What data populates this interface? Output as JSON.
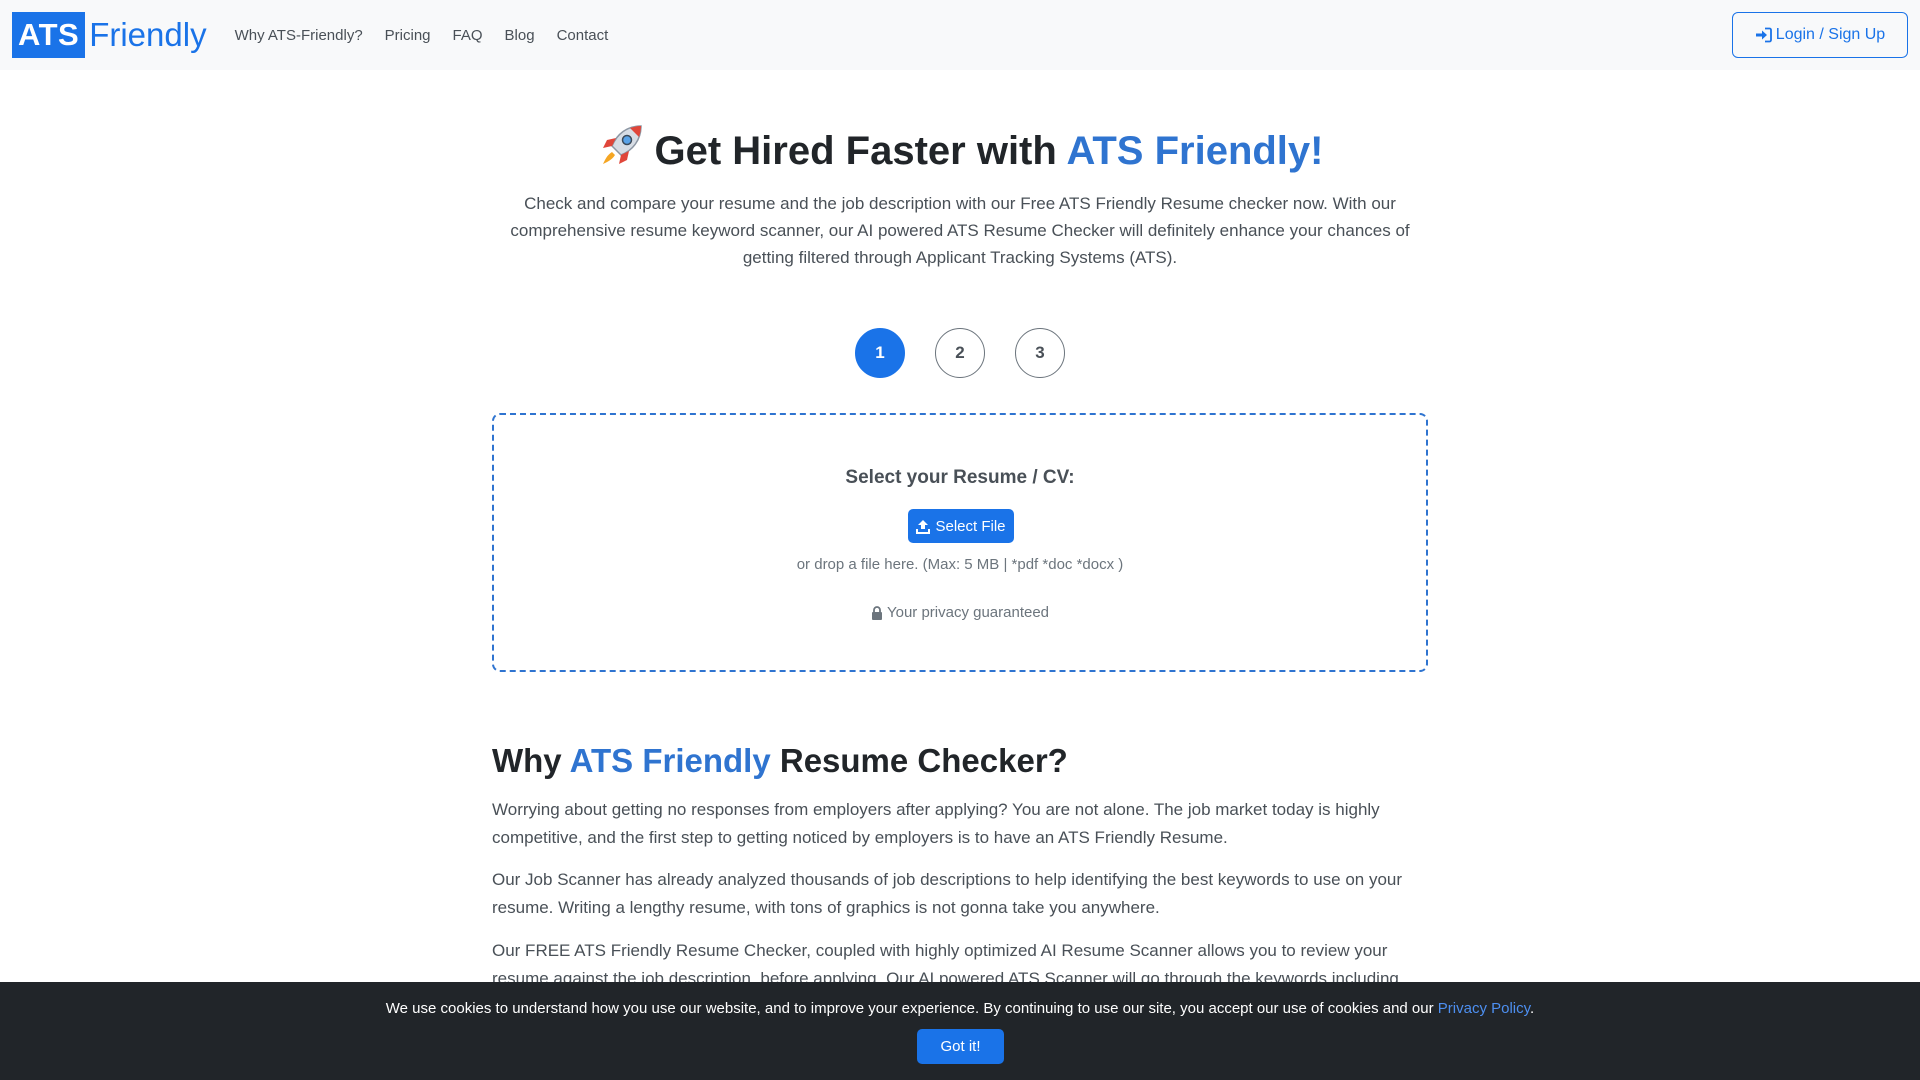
{
  "brand": {
    "logo_box": "ATS",
    "logo_text": "Friendly",
    "accent_color": "#1a73e8"
  },
  "nav": {
    "links": [
      "Why ATS-Friendly?",
      "Pricing",
      "FAQ",
      "Blog",
      "Contact"
    ],
    "login_label": "Login / Sign Up"
  },
  "hero": {
    "title_pre": "Get Hired Faster with ",
    "title_accent": "ATS Friendly!",
    "description": "Check and compare your resume and the job description with our Free ATS Friendly Resume checker now. With our comprehensive resume keyword scanner, our AI powered ATS Resume Checker will definitely enhance your chances of getting filtered through Applicant Tracking Systems (ATS)."
  },
  "steps": {
    "labels": [
      "1",
      "2",
      "3"
    ],
    "active": "1"
  },
  "upload": {
    "title": "Select your Resume / CV:",
    "button_label": "Select File",
    "hint": "or drop a file here. (Max: 5 MB | *pdf *doc *docx )",
    "privacy": "Your privacy guaranteed"
  },
  "why": {
    "title_pre": "Why ",
    "title_accent": "ATS Friendly",
    "title_post": " Resume Checker?",
    "paragraphs": [
      "Worrying about getting no responses from employers after applying? You are not alone. The job market today is highly competitive, and the first step to getting noticed by employers is to have an ATS Friendly Resume.",
      "Our Job Scanner has already analyzed thousands of job descriptions to help identifying the best keywords to use on your resume. Writing a lengthy resume, with tons of graphics is not gonna take you anywhere.",
      "Our FREE ATS Friendly Resume Checker, coupled with highly optimized AI Resume Scanner allows you to review your resume against the job description, before applying. Our AI powered ATS Scanner will go through the keywords including"
    ]
  },
  "cookie": {
    "text": "We use cookies to understand how you use our website, and to improve your experience. By continuing to use our site, you accept our use of cookies and our ",
    "link": "Privacy Policy",
    "suffix": ".",
    "button_label": "Got it!"
  }
}
